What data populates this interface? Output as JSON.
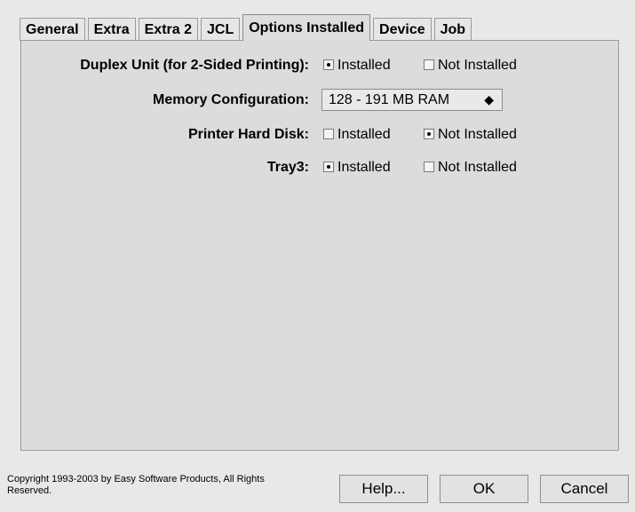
{
  "tabs": [
    {
      "label": "General"
    },
    {
      "label": "Extra"
    },
    {
      "label": "Extra 2"
    },
    {
      "label": "JCL"
    },
    {
      "label": "Options Installed"
    },
    {
      "label": "Device"
    },
    {
      "label": "Job"
    }
  ],
  "active_tab": "Options Installed",
  "options": {
    "duplex": {
      "label": "Duplex Unit (for 2-Sided Printing):",
      "opt1": "Installed",
      "opt2": "Not Installed",
      "selected": "Installed"
    },
    "memory": {
      "label": "Memory Configuration:",
      "value": "128 - 191 MB RAM",
      "arrow": "◆"
    },
    "harddisk": {
      "label": "Printer Hard Disk:",
      "opt1": "Installed",
      "opt2": "Not Installed",
      "selected": "Not Installed"
    },
    "tray3": {
      "label": "Tray3:",
      "opt1": "Installed",
      "opt2": "Not Installed",
      "selected": "Installed"
    }
  },
  "footer": {
    "copyright": "Copyright 1993-2003 by Easy Software Products, All Rights Reserved.",
    "help": "Help...",
    "ok": "OK",
    "cancel": "Cancel"
  },
  "icons": {
    "radio": "radio-button-icon",
    "select_arrow": "up-down-arrow-icon"
  }
}
